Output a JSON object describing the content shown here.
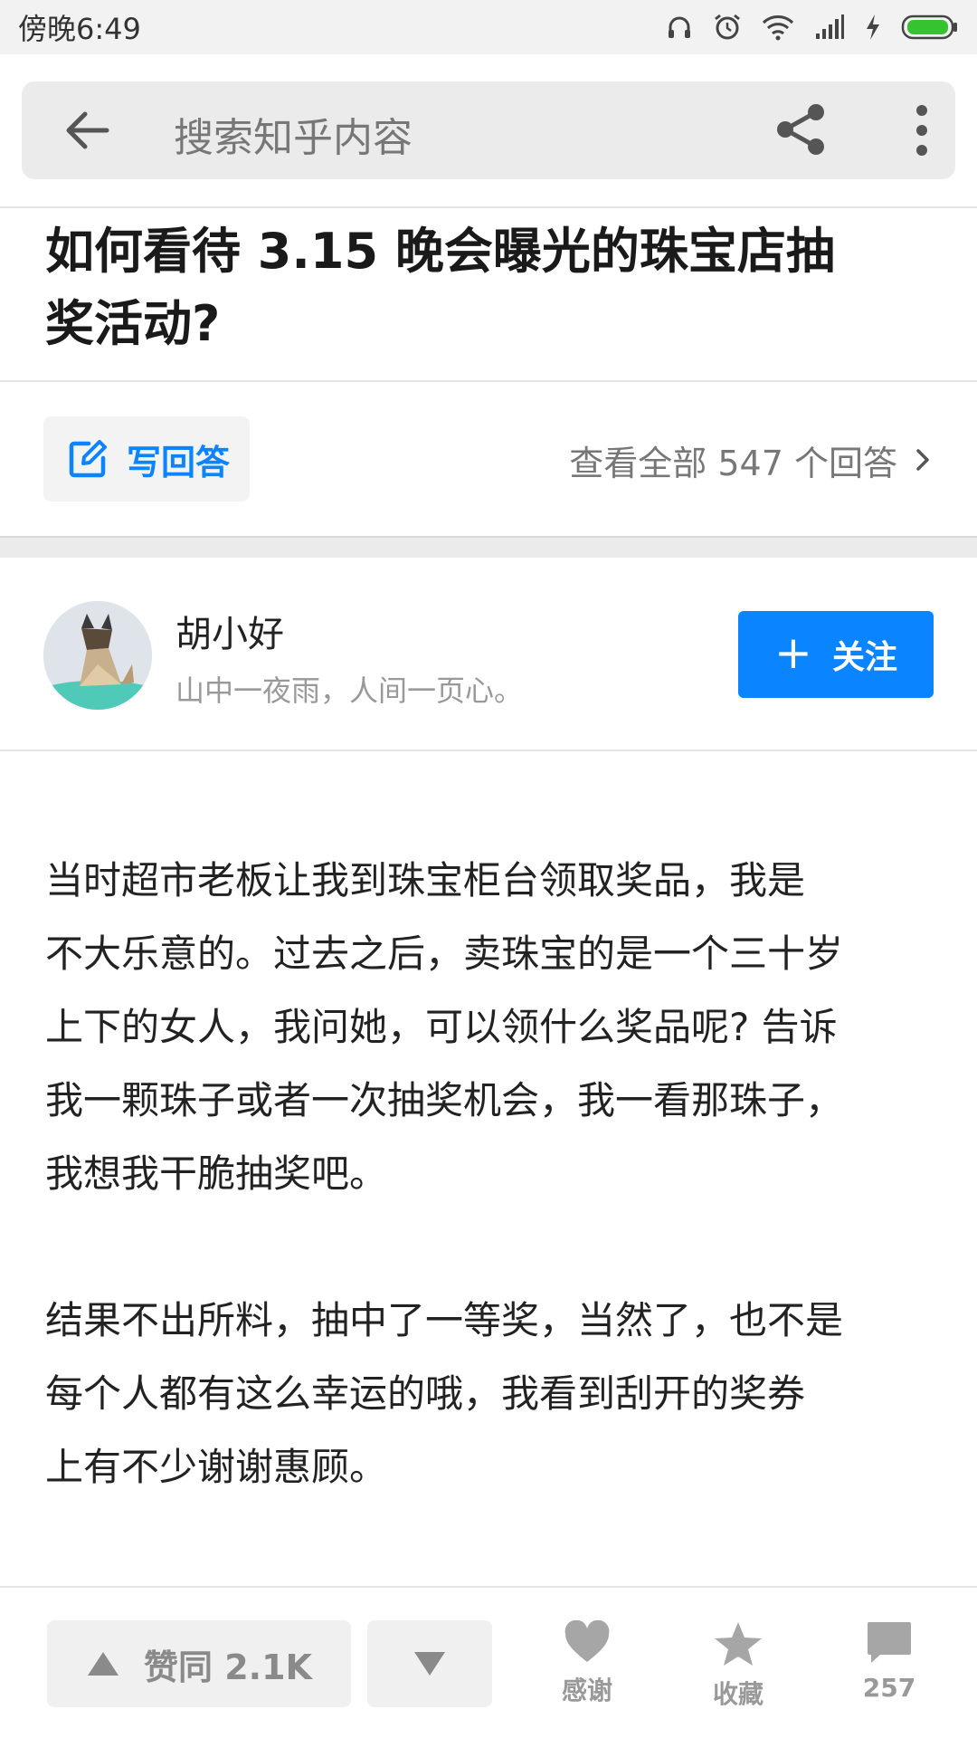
{
  "status_bar": {
    "time": "傍晚6:49"
  },
  "header": {
    "search_placeholder": "搜索知乎内容"
  },
  "question": {
    "title_line1": "如何看待 3.15 晚会曝光的珠宝店抽",
    "title_line2": "奖活动?"
  },
  "actions": {
    "write_answer": "写回答",
    "view_all": "查看全部 547 个回答"
  },
  "author": {
    "name": "胡小好",
    "bio": "山中一夜雨，人间一页心。",
    "follow_label": "关注"
  },
  "answer": {
    "paragraphs": [
      {
        "lines": [
          "当时超市老板让我到珠宝柜台领取奖品，我是",
          "不大乐意的。过去之后，卖珠宝的是一个三十岁",
          "上下的女人，我问她，可以领什么奖品呢? 告诉",
          "我一颗珠子或者一次抽奖机会，我一看那珠子，",
          "我想我干脆抽奖吧。"
        ]
      },
      {
        "lines": [
          "结果不出所料，抽中了一等奖，当然了，也不是",
          "每个人都有这么幸运的哦，我看到刮开的奖券",
          "上有不少谢谢惠顾。"
        ]
      }
    ]
  },
  "bottom_bar": {
    "vote_up_label": "赞同 2.1K",
    "thanks_label": "感谢",
    "collect_label": "收藏",
    "comment_count": "257"
  },
  "colors": {
    "accent": "#0a84ff",
    "status_bar_bg": "#f2f2f2",
    "search_bg": "#ebebeb"
  }
}
